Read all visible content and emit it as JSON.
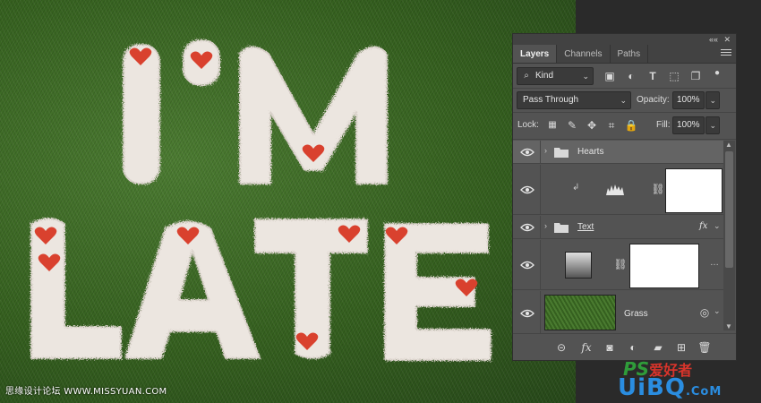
{
  "artwork": {
    "line1": "I'M",
    "line2": "LATE",
    "watermark_text": "思缘设计论坛 WWW.MISSYUAN.COM"
  },
  "panel": {
    "tabs": [
      {
        "label": "Layers",
        "active": true
      },
      {
        "label": "Channels",
        "active": false
      },
      {
        "label": "Paths",
        "active": false
      }
    ],
    "filter_kind": "Kind",
    "blend_mode": "Pass Through",
    "opacity_label": "Opacity:",
    "opacity_value": "100%",
    "lock_label": "Lock:",
    "fill_label": "Fill:",
    "fill_value": "100%",
    "layers": [
      {
        "name": "Hearts",
        "type": "group",
        "visible": true,
        "selected": true
      },
      {
        "name": "",
        "type": "adjustment",
        "visible": true,
        "clipped": true
      },
      {
        "name": "Text",
        "type": "group",
        "visible": true,
        "has_fx": true,
        "fx_label": "fx"
      },
      {
        "name": "",
        "type": "gradient-fill",
        "visible": true
      },
      {
        "name": "Grass",
        "type": "image",
        "visible": true
      }
    ]
  },
  "watermark": {
    "logo_ps": "PS",
    "logo_cn": "爱好者",
    "site_main": "UiBQ",
    "site_com": ".CoM"
  },
  "colors": {
    "panel_bg": "#535353",
    "panel_dark": "#424242",
    "heart": "#d9412e",
    "grass": "#3d6a27"
  }
}
